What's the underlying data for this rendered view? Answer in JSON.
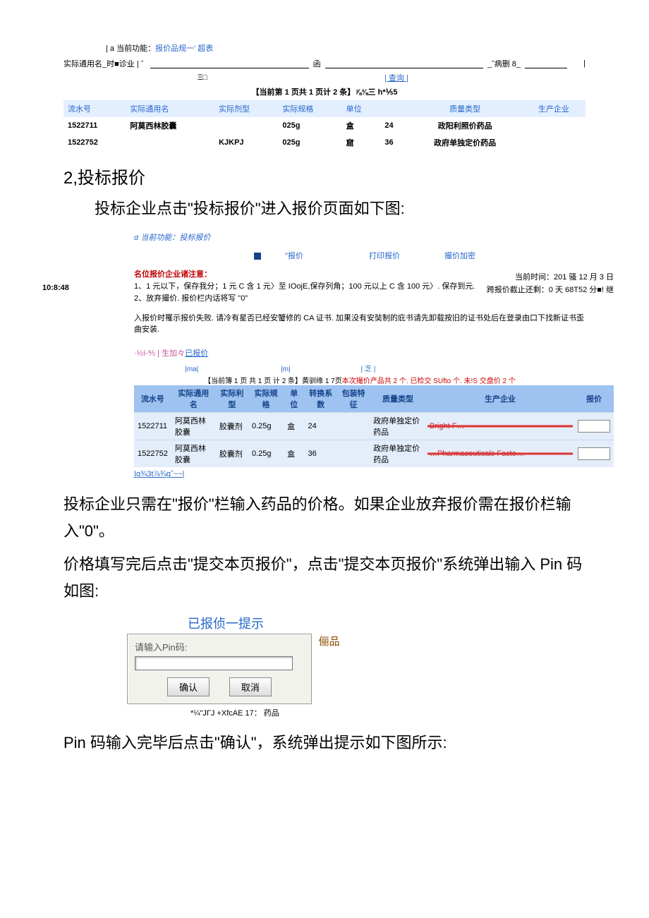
{
  "shot1": {
    "func_prefix": "| a 当前功能：",
    "func_text": "报价品规一' 超表",
    "search_label": "实际通用名_时■诊业 | ˆ",
    "mid_label": "函",
    "right_label": "_ˆ病删 8_",
    "caret": "|",
    "equals": "Ξ□",
    "query_link": "| 查询 |",
    "pager": "【当前第 1 页共 1 页计 2 条】⅞⅜三 h*⅕5",
    "headers": [
      "流水号",
      "实际通用名",
      "实际剂型",
      "实际规格",
      "单位",
      "",
      "质量类型",
      "生产企业"
    ],
    "rows": [
      [
        "1522711",
        "阿莫西林胶囊",
        "",
        "025g",
        "盒",
        "24",
        "政阳利照价药品",
        ""
      ],
      [
        "1522752",
        "",
        "KJKPJ",
        "025g",
        "窟",
        "36",
        "政府单独定价药品",
        ""
      ]
    ]
  },
  "sec2_title": "2,投标报价",
  "sec2_intro": "投标企业点击\"投标报价\"进入报价页面如下图:",
  "shot2": {
    "func_prefix": "α 当前功能：",
    "func_text": "投标报价",
    "toolbar": [
      "\"报价",
      "打印报价",
      "撮价加密"
    ],
    "notice_title": "名位报价企业诸注意：",
    "notice1": "1、1 元以下，保存我分；1 元 C 含 1 元〉至 IOojE,保存列角；100 元以上 C 含 100 元〉. 保存到元.",
    "notice2": "2、放弃撮价. 报价栏内话将写 \"0\"",
    "cur_time": "当前时间：201 骚 12 月 3 日",
    "time_left_label": "10:8:48",
    "deadline": "跨报价截止还剩：0 天 68T52 分■! 继",
    "notice3": "入报价时罹示报价失败. 请冷有星否已经安蟹修的 CA 证书. 加果没有安奘制的庇书请先卸载按旧的证书处后在登录由口下找新证书歪曲安装.",
    "tabs_prefix": "·½í-⅘  | 生加々",
    "tabs_link": "已报价",
    "ruler": "                          |ma|                                          |m|                                    | 乏 |",
    "pager": "【当前簿 1 页  共 1 页  计 2 条】黄驯缘 1 7页",
    "pager_red": "本次撮价产品共 2 个. 已检交 SUfto 个. 未!S 交盘价 2 个",
    "headers": [
      "流水号",
      "实际通用名",
      "实际利型",
      "实际規格",
      "单位",
      "转换系数",
      "包装特征",
      "质量类型",
      "生产企业",
      "报价"
    ],
    "rows": [
      [
        "1522711",
        "阿莫西林胶囊",
        "胶囊剂",
        "0.25g",
        "盒",
        "24",
        "",
        "政府单独定价药品",
        "Bright F…",
        ""
      ],
      [
        "1522752",
        "阿莫西林胶囊",
        "胶囊剂",
        "0.25g",
        "盒",
        "36",
        "",
        "政府单独定价药品",
        "…Pharmaceuticals Facto…",
        ""
      ]
    ],
    "below_link": "Ig¾3t⅞¾gˆ~~|"
  },
  "para1": "投标企业只需在\"报价\"栏输入药品的价格。如果企业放弃报价需在报价栏输入\"0\"。",
  "para2": "价格填写完后点击\"提交本页报价\"，点击\"提交本页报价\"系统弹出输入 Pin 码如图:",
  "pin": {
    "title": "已报侦一提示",
    "input_label": "请输入Pin码:",
    "ok": "确认",
    "cancel": "取消",
    "side": "俪品",
    "foot": "*¼\"JΓJ +XfcAE 17： 药品"
  },
  "para3": "Pin 码输入完毕后点击\"确认\"，系统弹出提示如下图所示:"
}
